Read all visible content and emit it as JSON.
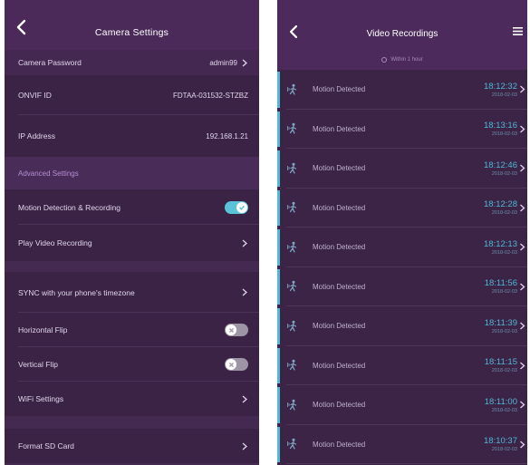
{
  "left": {
    "title": "Camera Settings",
    "camera_password": {
      "label": "Camera Password",
      "value": "admin99"
    },
    "onvif_id": {
      "label": "ONVIF ID",
      "value": "FDTAA-031532-STZBZ"
    },
    "ip_address": {
      "label": "IP Address",
      "value": "192.168.1.21"
    },
    "advanced_section": "Advanced Settings",
    "motion": {
      "label": "Motion Detection & Recording",
      "on": true
    },
    "play_video": {
      "label": "Play Video Recording"
    },
    "sync_tz": {
      "label": "SYNC with your phone's timezone"
    },
    "horizontal_flip": {
      "label": "Horizontal Flip",
      "on": false
    },
    "vertical_flip": {
      "label": "Vertical Flip",
      "on": false
    },
    "wifi": {
      "label": "WiFi Settings"
    },
    "format_sd": {
      "label": "Format SD Card"
    }
  },
  "right": {
    "title": "Video Recordings",
    "filter": "Within 1 hour",
    "recordings": [
      {
        "label": "Motion Detected",
        "time": "18:12:32",
        "date": "2018-02-03"
      },
      {
        "label": "Motion Detected",
        "time": "18:13:16",
        "date": "2018-02-03"
      },
      {
        "label": "Motion Detected",
        "time": "18:12:46",
        "date": "2018-02-03"
      },
      {
        "label": "Motion Detected",
        "time": "18:12:28",
        "date": "2018-02-03"
      },
      {
        "label": "Motion Detected",
        "time": "18:12:13",
        "date": "2018-02-03"
      },
      {
        "label": "Motion Detected",
        "time": "18:11:56",
        "date": "2018-02-03"
      },
      {
        "label": "Motion Detected",
        "time": "18:11:39",
        "date": "2018-02-03"
      },
      {
        "label": "Motion Detected",
        "time": "18:11:15",
        "date": "2018-02-03"
      },
      {
        "label": "Motion Detected",
        "time": "18:11:00",
        "date": "2018-02-03"
      },
      {
        "label": "Motion Detected",
        "time": "18:10:37",
        "date": "2018-02-03"
      }
    ]
  },
  "colors": {
    "accent": "#5bc3d8",
    "time": "#4fb7d5",
    "background": "#3a2345",
    "header": "#4b2a5a"
  },
  "icons": {
    "back": "chevron-left-icon",
    "row_chevron": "chevron-right-icon",
    "menu": "menu-icon",
    "recording": "motion-person-icon",
    "toggle_off": "x-icon",
    "toggle_on": "check-icon",
    "filter": "clock-icon"
  }
}
